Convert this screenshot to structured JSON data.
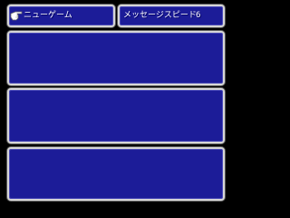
{
  "menu": {
    "new_game_label": "ニューゲーム",
    "message_speed_label": "メッセージスピード",
    "message_speed_value": "6",
    "cursor_icon": "hand-pointer-icon"
  },
  "save_slots": [
    {
      "content": ""
    },
    {
      "content": ""
    },
    {
      "content": ""
    }
  ],
  "colors": {
    "window_fill": "#1c1c98",
    "window_border": "#d6d6d6",
    "text": "#ffffff",
    "background": "#000000"
  }
}
